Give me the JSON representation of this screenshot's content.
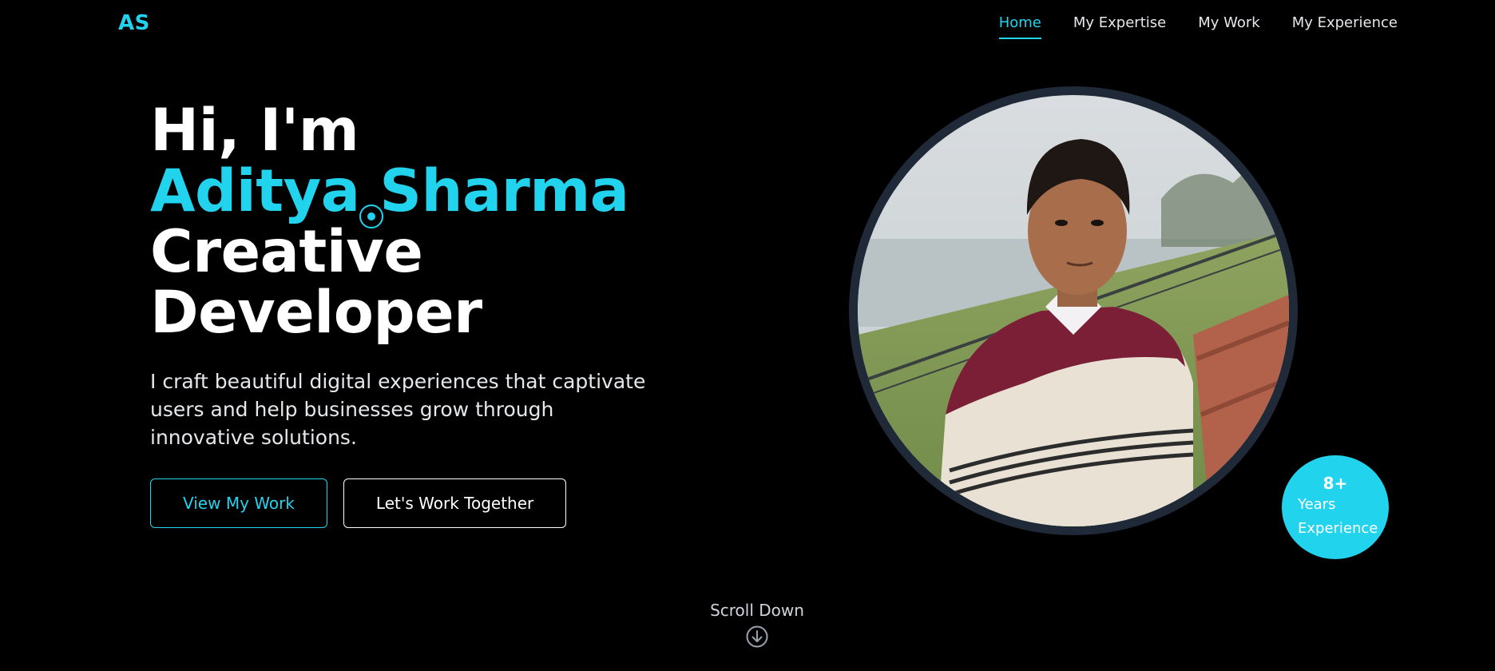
{
  "brand": {
    "logo": "AS",
    "accent_color": "#22d3ee"
  },
  "nav": {
    "items": [
      {
        "label": "Home",
        "active": true
      },
      {
        "label": "My Expertise",
        "active": false
      },
      {
        "label": "My Work",
        "active": false
      },
      {
        "label": "My Experience",
        "active": false
      }
    ]
  },
  "hero": {
    "greeting": "Hi, I'm",
    "name": "Aditya Sharma",
    "role_line1": "Creative",
    "role_line2": "Developer",
    "intro": "I craft beautiful digital experiences that captivate users and help businesses grow through innovative solutions.",
    "primary_button": "View My Work",
    "secondary_button": "Let's Work Together"
  },
  "portrait": {
    "icon": "profile-photo"
  },
  "badge": {
    "value": "8+",
    "line1": "Years",
    "line2": "Experience"
  },
  "scroll": {
    "label": "Scroll Down",
    "icon": "arrow-down-circle-icon"
  }
}
